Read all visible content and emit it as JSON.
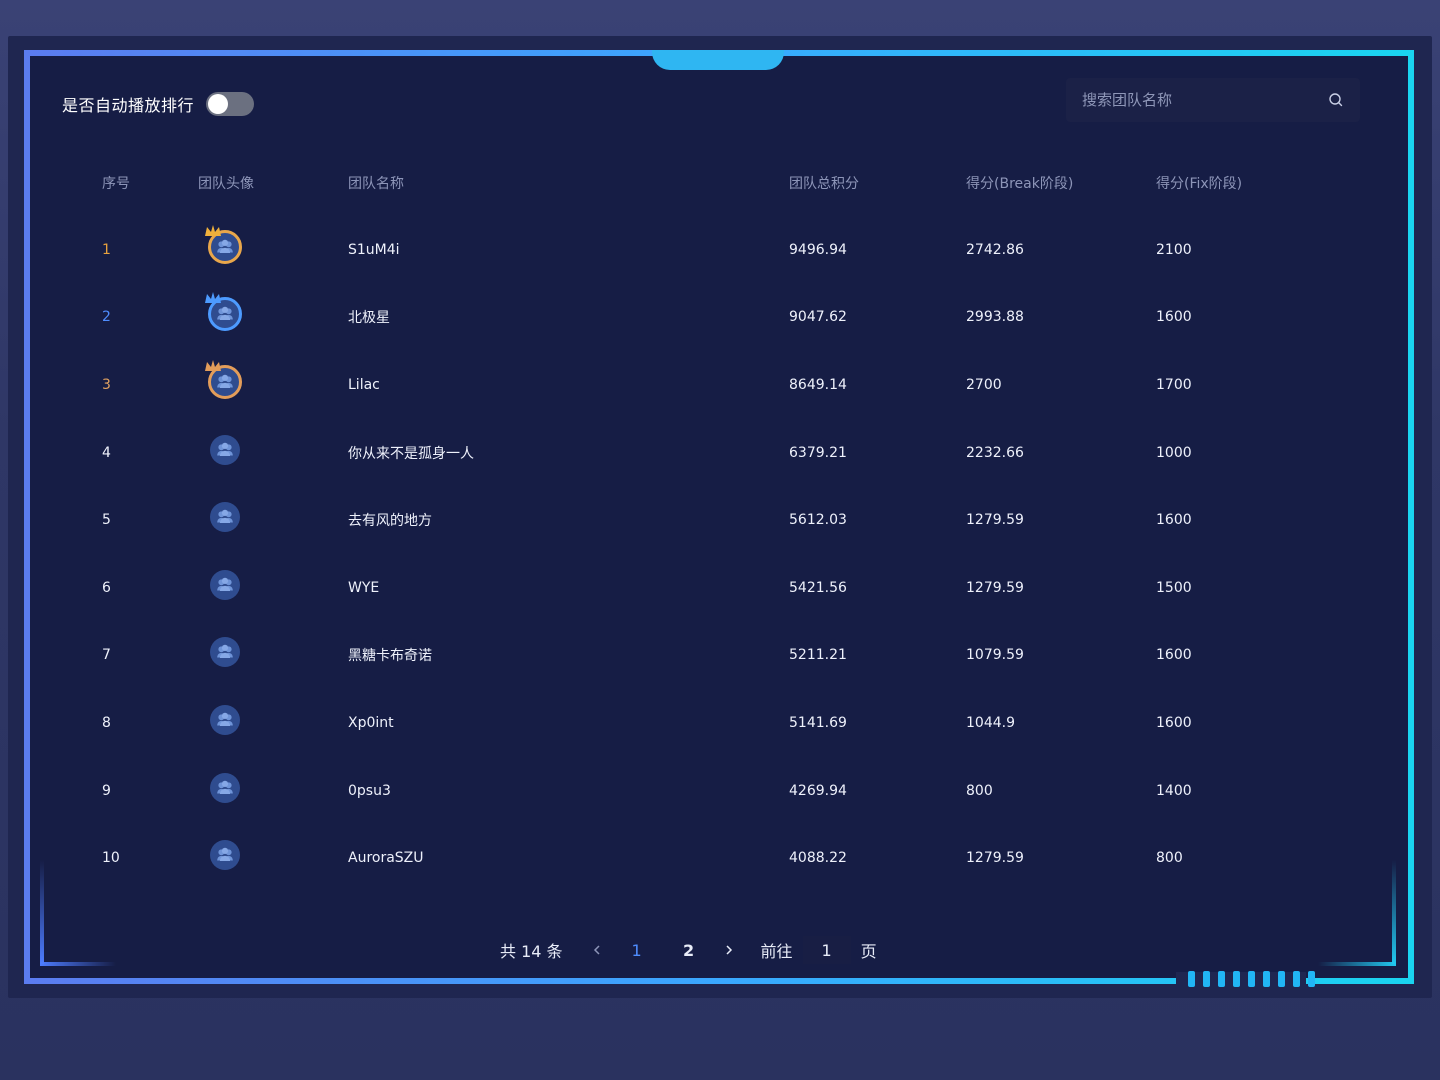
{
  "autoplay": {
    "label": "是否自动播放排行",
    "enabled": false
  },
  "search": {
    "placeholder": "搜索团队名称"
  },
  "table": {
    "headers": [
      "序号",
      "团队头像",
      "团队名称",
      "团队总积分",
      "得分(Break阶段)",
      "得分(Fix阶段)"
    ],
    "rows": [
      {
        "rank": "1",
        "name": "S1uM4i",
        "total": "9496.94",
        "break": "2742.86",
        "fix": "2100"
      },
      {
        "rank": "2",
        "name": "北极星",
        "total": "9047.62",
        "break": "2993.88",
        "fix": "1600"
      },
      {
        "rank": "3",
        "name": "Lilac",
        "total": "8649.14",
        "break": "2700",
        "fix": "1700"
      },
      {
        "rank": "4",
        "name": "你从来不是孤身一人",
        "total": "6379.21",
        "break": "2232.66",
        "fix": "1000"
      },
      {
        "rank": "5",
        "name": "去有风的地方",
        "total": "5612.03",
        "break": "1279.59",
        "fix": "1600"
      },
      {
        "rank": "6",
        "name": "WYE",
        "total": "5421.56",
        "break": "1279.59",
        "fix": "1500"
      },
      {
        "rank": "7",
        "name": "黑糖卡布奇诺",
        "total": "5211.21",
        "break": "1079.59",
        "fix": "1600"
      },
      {
        "rank": "8",
        "name": "Xp0int",
        "total": "5141.69",
        "break": "1044.9",
        "fix": "1600"
      },
      {
        "rank": "9",
        "name": "0psu3",
        "total": "4269.94",
        "break": "800",
        "fix": "1400"
      },
      {
        "rank": "10",
        "name": "AuroraSZU",
        "total": "4088.22",
        "break": "1279.59",
        "fix": "800"
      }
    ]
  },
  "pagination": {
    "total_label": "共 14 条",
    "pages": [
      "1",
      "2"
    ],
    "current_page": "1",
    "goto_label": "前往",
    "goto_value": "1",
    "page_suffix": "页"
  },
  "colors": {
    "accent_blue": "#4f8dff",
    "gold": "#e7a13e",
    "bronze": "#e0a160",
    "frame_cyan": "#21c8f0"
  },
  "icons": {
    "search": "search-icon",
    "prev": "chevron-left-icon",
    "next": "chevron-right-icon",
    "avatar": "team-avatar-icon",
    "crown": "crown-icon"
  }
}
